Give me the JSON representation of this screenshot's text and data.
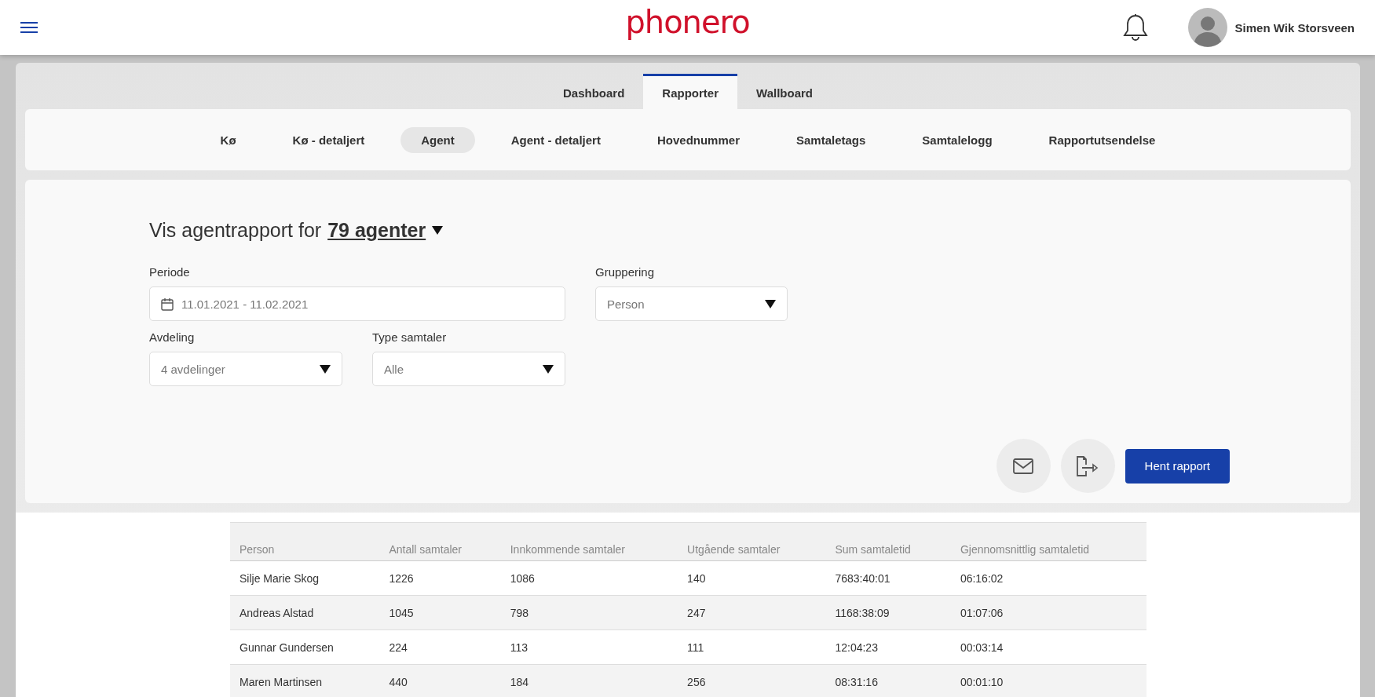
{
  "header": {
    "logo": "phonero",
    "user_name": "Simen Wik Storsveen"
  },
  "tabs": [
    {
      "label": "Dashboard",
      "selected": false
    },
    {
      "label": "Rapporter",
      "selected": true
    },
    {
      "label": "Wallboard",
      "selected": false
    }
  ],
  "sub_tabs": [
    {
      "label": "Kø",
      "selected": false
    },
    {
      "label": "Kø - detaljert",
      "selected": false
    },
    {
      "label": "Agent",
      "selected": true
    },
    {
      "label": "Agent - detaljert",
      "selected": false
    },
    {
      "label": "Hovednummer",
      "selected": false
    },
    {
      "label": "Samtaletags",
      "selected": false
    },
    {
      "label": "Samtalelogg",
      "selected": false
    },
    {
      "label": "Rapportutsendelse",
      "selected": false
    }
  ],
  "report_form": {
    "title": "Vis agentrapport for",
    "agents_link": "79 agenter",
    "fields": [
      {
        "kind": "date",
        "label": "Periode",
        "value": "11.01.2021 - 11.02.2021"
      },
      {
        "kind": "select",
        "label": "Gruppering",
        "value": "Person"
      },
      {
        "kind": "select",
        "label": "Avdeling",
        "value": "4 avdelinger"
      },
      {
        "kind": "select",
        "label": "Type samtaler",
        "value": "Alle"
      }
    ],
    "submit_button": "Hent rapport"
  },
  "table": {
    "columns": [
      "Person",
      "Antall samtaler",
      "Innkommende samtaler",
      "Utgående samtaler",
      "Sum samtaletid",
      "Gjennomsnittlig samtaletid"
    ],
    "rows": [
      [
        "Silje Marie Skog",
        "1226",
        "1086",
        "140",
        "7683:40:01",
        "06:16:02"
      ],
      [
        "Andreas Alstad",
        "1045",
        "798",
        "247",
        "1168:38:09",
        "01:07:06"
      ],
      [
        "Gunnar Gundersen",
        "224",
        "113",
        "111",
        "12:04:23",
        "00:03:14"
      ],
      [
        "Maren Martinsen",
        "440",
        "184",
        "256",
        "08:31:16",
        "00:01:10"
      ]
    ]
  }
}
